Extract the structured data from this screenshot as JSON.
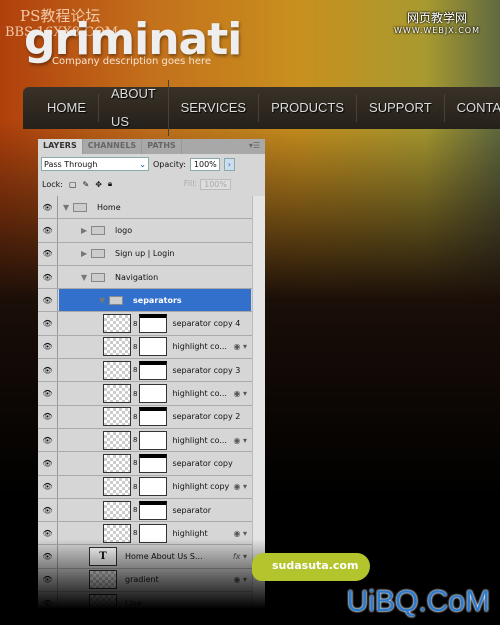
{
  "watermarks": {
    "top_left": "PS教程论坛",
    "top_left_2": "BBS.16XX8.COM",
    "top_right": "网页教学网",
    "top_right_url": "WWW.WEBJX.COM",
    "bubble": "sudasuta.com",
    "bottom_right": "UiBQ.CoM"
  },
  "site": {
    "logo": "griminati",
    "tagline": "Company description goes here",
    "nav": [
      "HOME",
      "ABOUT US",
      "SERVICES",
      "PRODUCTS",
      "SUPPORT",
      "CONTACT"
    ]
  },
  "panel": {
    "tabs": [
      "LAYERS",
      "CHANNELS",
      "PATHS"
    ],
    "menu_icon": "panel-menu-icon",
    "blend_mode": "Pass Through",
    "opacity_label": "Opacity:",
    "opacity": "100%",
    "lock_label": "Lock:",
    "fill_label": "Fill:",
    "fill": "100%",
    "layers": [
      {
        "name": "Home",
        "type": "group",
        "indent": 0,
        "open": true
      },
      {
        "name": "logo",
        "type": "group",
        "indent": 1,
        "open": false
      },
      {
        "name": "Sign up   |   Login",
        "type": "group",
        "indent": 1,
        "open": false
      },
      {
        "name": "Navigation",
        "type": "group",
        "indent": 1,
        "open": true
      },
      {
        "name": "separators",
        "type": "group",
        "indent": 2,
        "open": true,
        "selected": true
      },
      {
        "name": "separator copy 4",
        "type": "mask",
        "bar": true
      },
      {
        "name": "highlight co...",
        "type": "mask",
        "fx": true
      },
      {
        "name": "separator copy 3",
        "type": "mask",
        "bar": true
      },
      {
        "name": "highlight co...",
        "type": "mask",
        "fx": true
      },
      {
        "name": "separator copy 2",
        "type": "mask",
        "bar": true
      },
      {
        "name": "highlight co...",
        "type": "mask",
        "fx": true
      },
      {
        "name": "separator copy",
        "type": "mask",
        "bar": true
      },
      {
        "name": "highlight copy",
        "type": "mask",
        "fx": true
      },
      {
        "name": "separator",
        "type": "mask",
        "bar": true
      },
      {
        "name": "highlight",
        "type": "mask",
        "fx": true
      },
      {
        "name": "Home       About Us       S...",
        "type": "text",
        "fxlabel": "fx"
      },
      {
        "name": "gradient",
        "type": "smart",
        "fx": true
      },
      {
        "name": "Line",
        "type": "pixel"
      }
    ]
  }
}
